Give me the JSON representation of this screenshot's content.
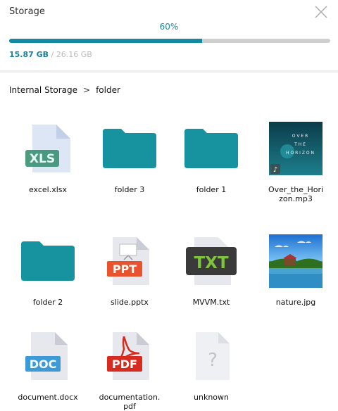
{
  "header": {
    "title": "Storage",
    "percent_text": "60%",
    "progress": 0.6,
    "used": "15.87 GB",
    "total": " / 26.16 GB"
  },
  "breadcrumb": {
    "root": "Internal Storage",
    "separator": ">",
    "current": "folder"
  },
  "files": [
    {
      "name": "excel.xlsx",
      "icon": "xls-file-icon",
      "badge": "XLS"
    },
    {
      "name": "folder 3",
      "icon": "folder-icon"
    },
    {
      "name": "folder 1",
      "icon": "folder-icon"
    },
    {
      "name": "Over_the_Hori\nzon.mp3",
      "icon": "album-art-thumbnail",
      "art_lines": [
        "O V E R",
        "T H E",
        "H O R I Z O N"
      ]
    },
    {
      "name": "folder 2",
      "icon": "folder-icon"
    },
    {
      "name": "slide.pptx",
      "icon": "ppt-file-icon",
      "badge": "PPT"
    },
    {
      "name": "MVVM.txt",
      "icon": "txt-file-icon",
      "badge": "TXT"
    },
    {
      "name": "nature.jpg",
      "icon": "image-thumbnail"
    },
    {
      "name": "document.docx",
      "icon": "doc-file-icon",
      "badge": "DOC"
    },
    {
      "name": "documentation.\npdf",
      "icon": "pdf-file-icon",
      "badge": "PDF"
    },
    {
      "name": "unknown",
      "icon": "unknown-file-icon",
      "badge": "?"
    }
  ],
  "colors": {
    "accent": "#1888a2",
    "folder": "#17939f",
    "xls": "#2e8b6a",
    "ppt": "#e8532e",
    "txt": "#3a3a3a",
    "txt_badge": "#7fc43d",
    "doc": "#3a9bd8",
    "pdf": "#d62b1e"
  }
}
